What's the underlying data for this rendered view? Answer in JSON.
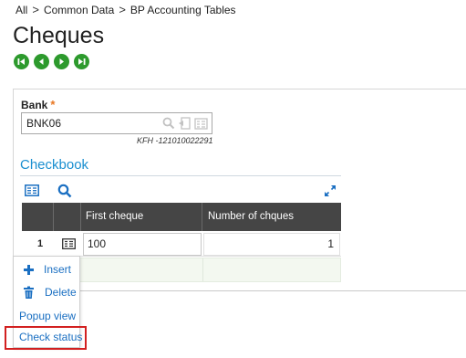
{
  "breadcrumb": {
    "items": [
      "All",
      "Common Data",
      "BP Accounting Tables"
    ],
    "separator": ">"
  },
  "page": {
    "title": "Cheques"
  },
  "nav_buttons": [
    "first-icon",
    "previous-icon",
    "next-icon",
    "last-icon"
  ],
  "bank": {
    "label": "Bank",
    "required_marker": "*",
    "value": "BNK06",
    "subtext": "KFH -121010022291"
  },
  "checkbook": {
    "title": "Checkbook",
    "columns": [
      "First cheque",
      "Number of chques"
    ],
    "rows": [
      {
        "num": "1",
        "first_cheque": "100",
        "count": "1"
      }
    ]
  },
  "context_menu": {
    "insert": "Insert",
    "delete": "Delete",
    "popup_view": "Popup view",
    "check_status": "Check status"
  },
  "colors": {
    "accent": "#1a8fd0",
    "nav_green": "#2d9a2d",
    "header_dark": "#454545",
    "highlight_red": "#d22020"
  }
}
